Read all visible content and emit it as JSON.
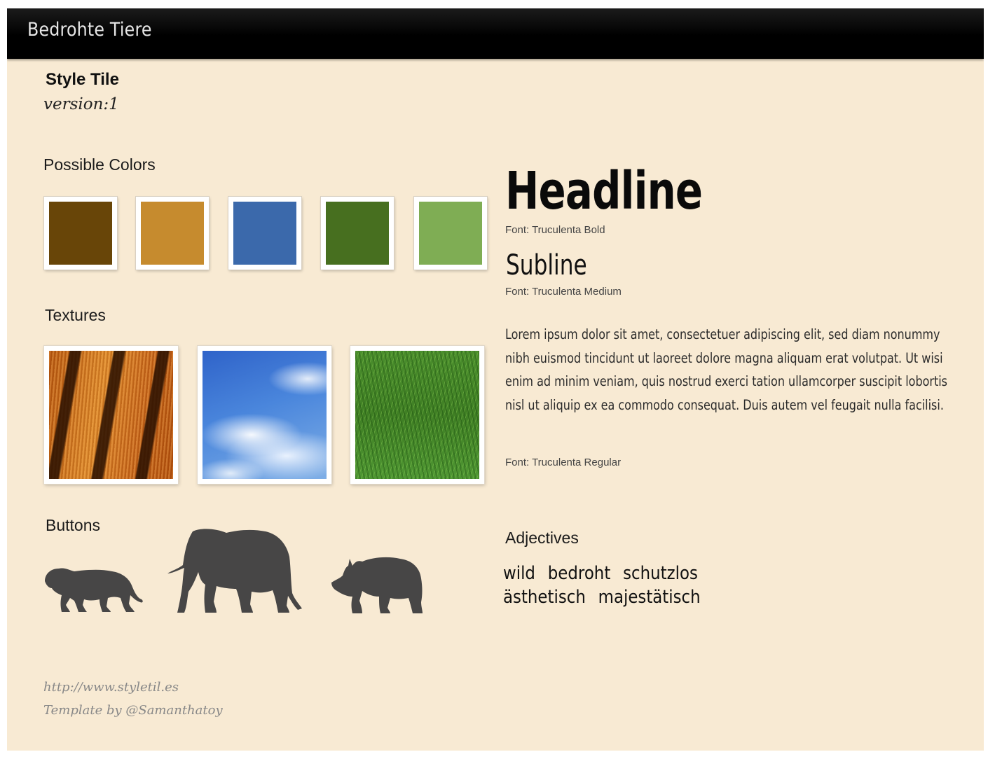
{
  "header": {
    "brand": "Bedrohte Tiere"
  },
  "tile": {
    "title": "Style Tile",
    "version": "version:1"
  },
  "sections": {
    "colors": "Possible Colors",
    "textures": "Textures",
    "buttons": "Buttons",
    "adjectives": "Adjectives"
  },
  "colors": [
    "#684508",
    "#c68b2e",
    "#3b69ab",
    "#476f1f",
    "#7fad54"
  ],
  "textures": [
    "tiger-fur",
    "sky-clouds",
    "grass"
  ],
  "typography": {
    "headline": "Headline",
    "headline_font": "Font: Truculenta Bold",
    "subline": "Subline",
    "subline_font": "Font: Truculenta Medium",
    "body": "Lorem ipsum dolor sit amet, consectetuer adipiscing elit, sed diam nonummy nibh euismod tincidunt ut laoreet dolore magna aliquam erat volutpat. Ut wisi enim ad minim veniam, quis nostrud exerci tation ullamcorper suscipit lobortis nisl ut aliquip ex ea commodo consequat. Duis autem vel feugait nulla facilisi.",
    "body_font": "Font: Truculenta Regular"
  },
  "buttons": [
    "lion-icon",
    "elephant-icon",
    "rhino-icon"
  ],
  "adjectives": [
    "wild",
    "bedroht",
    "schutzlos",
    "ästhetisch",
    "majestätisch"
  ],
  "footer": {
    "url": "http://www.styletil.es",
    "credit": "Template by @Samanthatoy"
  }
}
